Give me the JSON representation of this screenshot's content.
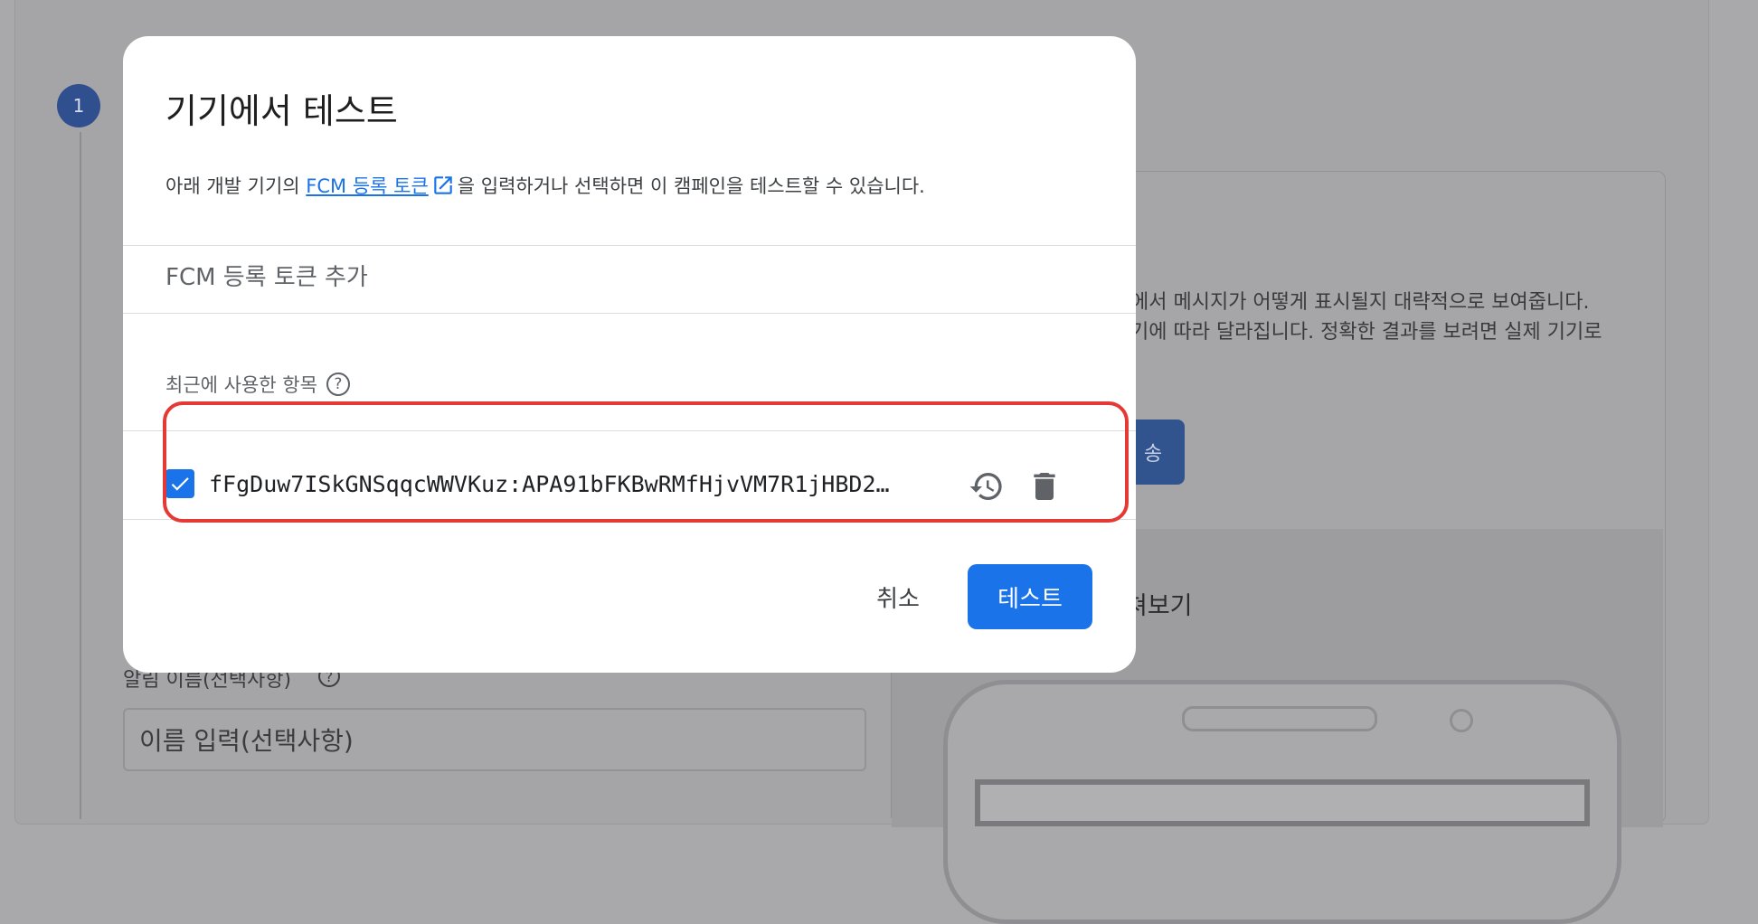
{
  "background": {
    "step_number": "1",
    "preview_text_line1": "에서 메시지가 어떻게 표시될지 대략적으로 보여줍니다.",
    "preview_text_line2": "기에 따라 달라집니다. 정확한 결과를 보려면 실제 기기로",
    "send_button_label": "송",
    "preview_title": "쳐보기",
    "field_label": "알림 이름(선택사항)",
    "help_glyph": "?",
    "name_input_placeholder": "이름 입력(선택사항)"
  },
  "dialog": {
    "title": "기기에서 테스트",
    "description_prefix": "아래 개발 기기의",
    "description_link": "FCM 등록 토큰",
    "description_suffix": "을 입력하거나 선택하면 이 캠페인을 테스트할 수 있습니다.",
    "token_input_placeholder": "FCM 등록 토큰 추가",
    "recent_label": "최근에 사용한 항목",
    "help_glyph": "?",
    "recent_tokens": [
      {
        "token": "fFgDuw7ISkGNSqqcWWVKuz:APA91bFKBwRMfHjvVM7R1jHBD2…",
        "checked": true
      }
    ],
    "cancel_label": "취소",
    "test_label": "테스트"
  },
  "icons": {
    "external_link": "open-in-new-icon",
    "history": "history-icon",
    "delete": "trash-icon",
    "check": "check-icon",
    "help": "help-circle-icon"
  },
  "colors": {
    "accent": "#1a73e8",
    "highlight": "#e53935",
    "overlay": "#a9a9ac"
  }
}
